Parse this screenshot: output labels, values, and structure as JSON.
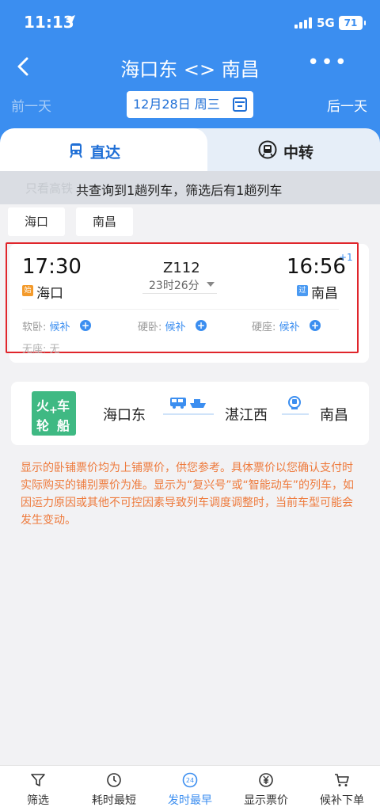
{
  "status_bar": {
    "time": "11:13",
    "network": "5G",
    "battery": "71"
  },
  "nav": {
    "title": "海口东 <> 南昌",
    "more": "•••"
  },
  "date_bar": {
    "prev": "前一天",
    "date": "12月28日 周三",
    "next": "后一天"
  },
  "tabs": [
    {
      "label": "直达",
      "active": true
    },
    {
      "label": "中转",
      "active": false
    }
  ],
  "notice": {
    "faded": "只看高铁",
    "text": "共查询到1趟列车，筛选后有1趟列车"
  },
  "filters": [
    "海口",
    "南昌"
  ],
  "train": {
    "departure_time": "17:30",
    "arrival_time": "16:56",
    "day_offset": "+1",
    "number": "Z112",
    "duration": "23时26分",
    "from_badge": "始",
    "from_station": "海口",
    "to_badge": "过",
    "to_station": "南昌",
    "seats": [
      {
        "label": "软卧:",
        "value": "候补"
      },
      {
        "label": "硬卧:",
        "value": "候补"
      },
      {
        "label": "硬座:",
        "value": "候补"
      }
    ],
    "no_seat": "无座: 无"
  },
  "combo": {
    "logo": [
      "火",
      "车",
      "轮",
      "船",
      "+"
    ],
    "stops": [
      "海口东",
      "湛江西",
      "南昌"
    ]
  },
  "disclaimer": "显示的卧铺票价均为上铺票价，供您参考。具体票价以您确认支付时实际购买的铺别票价为准。显示为“复兴号”或“智能动车”的列车，如因运力原因或其他不可控因素导致列车调度调整时，当前车型可能会发生变动。",
  "bottom_bar": [
    {
      "label": "筛选",
      "icon": "filter-icon",
      "active": false
    },
    {
      "label": "耗时最短",
      "icon": "clock-icon",
      "active": false
    },
    {
      "label": "发时最早",
      "icon": "clock-24-icon",
      "active": true
    },
    {
      "label": "显示票价",
      "icon": "yen-icon",
      "active": false
    },
    {
      "label": "候补下单",
      "icon": "cart-icon",
      "active": false
    }
  ],
  "colors": {
    "primary": "#3b8ef0",
    "accent_orange": "#ee7a3c",
    "highlight_red": "#e0252b",
    "green": "#3fb983"
  }
}
